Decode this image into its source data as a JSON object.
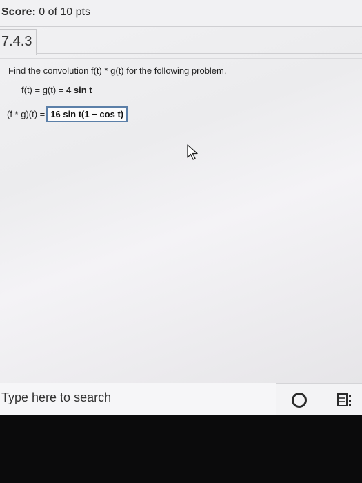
{
  "header": {
    "score_label": "Score:",
    "score_value": "0 of 10 pts"
  },
  "section": {
    "number": "7.4.3"
  },
  "question": {
    "prompt": "Find the convolution f(t) * g(t) for the following problem.",
    "given_prefix": "f(t) = g(t) = ",
    "given_value": "4 sin t",
    "answer_label": "(f * g)(t) =",
    "answer_value": "16 sin t(1 − cos t)"
  },
  "taskbar": {
    "search_placeholder": "Type here to search",
    "icons": [
      "cortana-icon",
      "task-view-icon"
    ]
  },
  "colors": {
    "answer_border": "#5b7fa8",
    "screen_bg": "#f1f1f3",
    "bezel": "#0b0b0c"
  }
}
